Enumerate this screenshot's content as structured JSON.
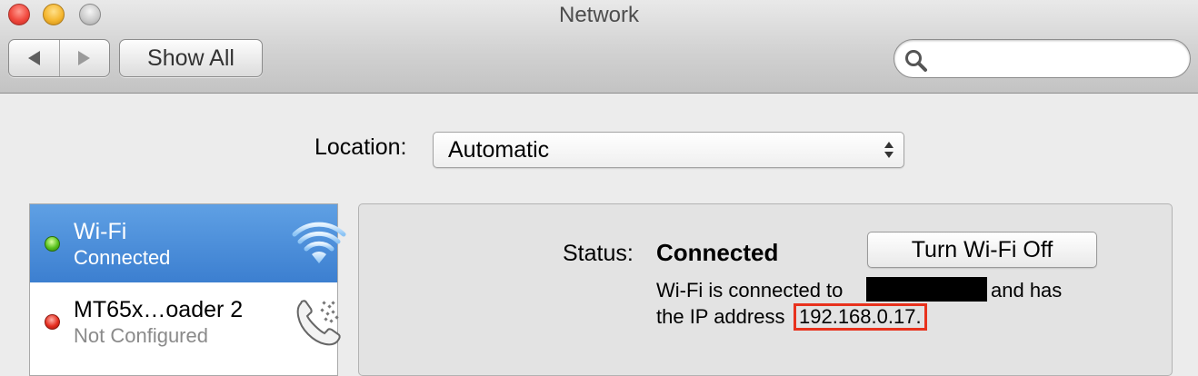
{
  "window": {
    "title": "Network",
    "buttons": [
      "close",
      "minimize",
      "zoom"
    ]
  },
  "toolbar": {
    "back_icon": "back-arrow-icon",
    "forward_icon": "forward-arrow-icon",
    "show_all_label": "Show All",
    "search": {
      "value": "",
      "placeholder": ""
    }
  },
  "location": {
    "label": "Location:",
    "value": "Automatic"
  },
  "services": [
    {
      "name": "Wi-Fi",
      "status": "Connected",
      "status_color": "#58c21d",
      "icon": "wifi-icon",
      "selected": true
    },
    {
      "name": "MT65x…oader 2",
      "status": "Not Configured",
      "status_color": "#e52d1f",
      "icon": "phone-modem-icon",
      "selected": false
    }
  ],
  "detail": {
    "status_label": "Status:",
    "status_value": "Connected",
    "toggle_button_label": "Turn Wi-Fi Off",
    "description": {
      "line1_prefix": "Wi-Fi is connected to",
      "line1_suffix": "and has",
      "line2_prefix": "the IP address",
      "ip_address": "192.168.0.17."
    }
  },
  "colors": {
    "selection": "#3c7fd0",
    "highlight_box": "#e8321d"
  }
}
